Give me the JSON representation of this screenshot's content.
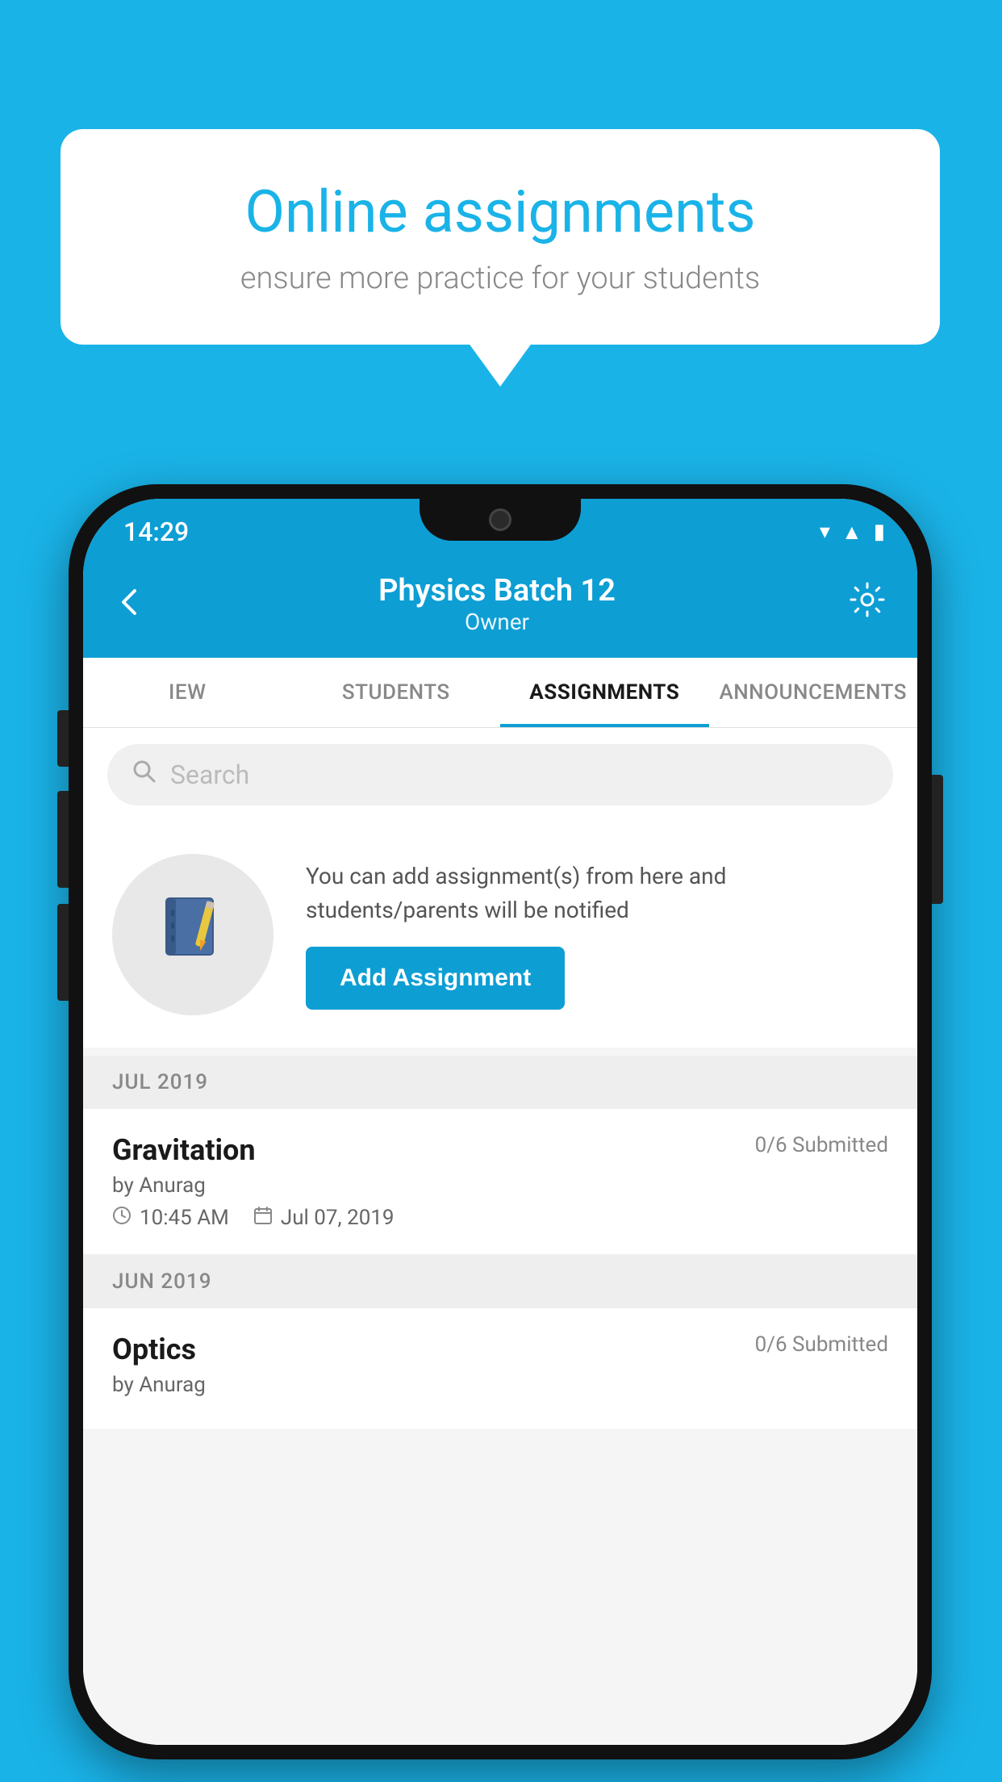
{
  "background_color": "#1ab3e8",
  "speech_bubble": {
    "title": "Online assignments",
    "subtitle": "ensure more practice for your students"
  },
  "phone": {
    "status_bar": {
      "time": "14:29",
      "icons": [
        "wifi",
        "signal",
        "battery"
      ]
    },
    "header": {
      "title": "Physics Batch 12",
      "subtitle": "Owner",
      "back_label": "←",
      "settings_label": "⚙"
    },
    "tabs": [
      {
        "id": "iew",
        "label": "IEW",
        "active": false
      },
      {
        "id": "students",
        "label": "STUDENTS",
        "active": false
      },
      {
        "id": "assignments",
        "label": "ASSIGNMENTS",
        "active": true
      },
      {
        "id": "announcements",
        "label": "ANNOUNCEMENTS",
        "active": false
      }
    ],
    "search": {
      "placeholder": "Search"
    },
    "promo": {
      "description": "You can add assignment(s) from here and students/parents will be notified",
      "button_label": "Add Assignment"
    },
    "assignment_groups": [
      {
        "month_label": "JUL 2019",
        "assignments": [
          {
            "name": "Gravitation",
            "submitted": "0/6 Submitted",
            "by": "by Anurag",
            "time": "10:45 AM",
            "date": "Jul 07, 2019"
          }
        ]
      },
      {
        "month_label": "JUN 2019",
        "assignments": [
          {
            "name": "Optics",
            "submitted": "0/6 Submitted",
            "by": "by Anurag",
            "time": "",
            "date": ""
          }
        ]
      }
    ]
  }
}
